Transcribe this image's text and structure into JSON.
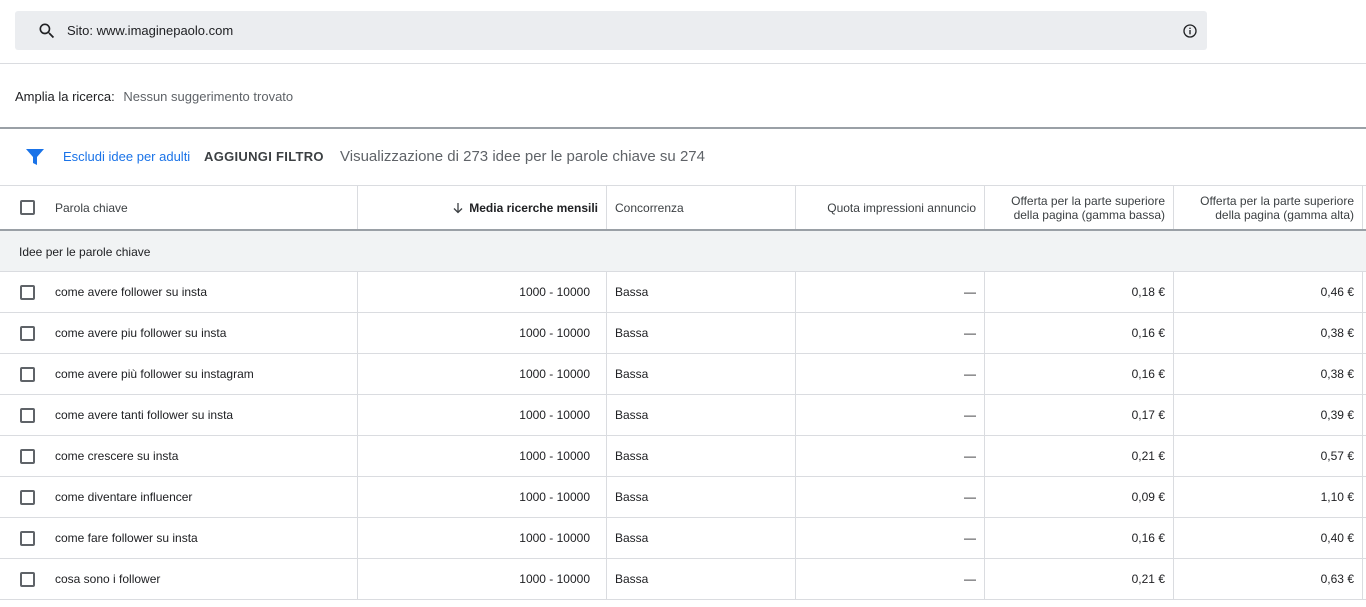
{
  "search": {
    "text": "Sito: www.imaginepaolo.com"
  },
  "expand": {
    "label": "Amplia la ricerca:",
    "value": "Nessun suggerimento trovato"
  },
  "filters": {
    "chip": "Escludi idee per adulti",
    "add": "AGGIUNGI FILTRO",
    "summary": "Visualizzazione di 273 idee per le parole chiave su 274"
  },
  "table": {
    "headers": {
      "keyword": "Parola chiave",
      "searches": "Media ricerche mensili",
      "competition": "Concorrenza",
      "impression_share": "Quota impressioni annuncio",
      "bid_low_1": "Offerta per la parte superiore",
      "bid_low_2": "della pagina (gamma bassa)",
      "bid_high_1": "Offerta per la parte superiore",
      "bid_high_2": "della pagina (gamma alta)"
    },
    "group_label": "Idee per le parole chiave",
    "rows": [
      {
        "keyword": "come avere follower su insta",
        "searches": "1000 - 10000",
        "competition": "Bassa",
        "impression_share": "—",
        "bid_low": "0,18 €",
        "bid_high": "0,46 €"
      },
      {
        "keyword": "come avere piu follower su insta",
        "searches": "1000 - 10000",
        "competition": "Bassa",
        "impression_share": "—",
        "bid_low": "0,16 €",
        "bid_high": "0,38 €"
      },
      {
        "keyword": "come avere più follower su instagram",
        "searches": "1000 - 10000",
        "competition": "Bassa",
        "impression_share": "—",
        "bid_low": "0,16 €",
        "bid_high": "0,38 €"
      },
      {
        "keyword": "come avere tanti follower su insta",
        "searches": "1000 - 10000",
        "competition": "Bassa",
        "impression_share": "—",
        "bid_low": "0,17 €",
        "bid_high": "0,39 €"
      },
      {
        "keyword": "come crescere su insta",
        "searches": "1000 - 10000",
        "competition": "Bassa",
        "impression_share": "—",
        "bid_low": "0,21 €",
        "bid_high": "0,57 €"
      },
      {
        "keyword": "come diventare influencer",
        "searches": "1000 - 10000",
        "competition": "Bassa",
        "impression_share": "—",
        "bid_low": "0,09 €",
        "bid_high": "1,10 €"
      },
      {
        "keyword": "come fare follower su insta",
        "searches": "1000 - 10000",
        "competition": "Bassa",
        "impression_share": "—",
        "bid_low": "0,16 €",
        "bid_high": "0,40 €"
      },
      {
        "keyword": "cosa sono i follower",
        "searches": "1000 - 10000",
        "competition": "Bassa",
        "impression_share": "—",
        "bid_low": "0,21 €",
        "bid_high": "0,63 €"
      }
    ]
  },
  "colors": {
    "accent": "#1a73e8",
    "search_bg": "#ebedf0",
    "group_bg": "#f1f3f4"
  }
}
